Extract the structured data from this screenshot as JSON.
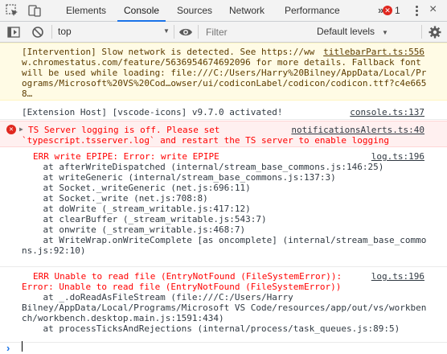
{
  "tabs": {
    "items": [
      "Elements",
      "Console",
      "Sources",
      "Network",
      "Performance"
    ],
    "more": "»",
    "error_count": "1",
    "close": "×"
  },
  "toolbar": {
    "context": "top",
    "filter_placeholder": "Filter",
    "levels": "Default levels"
  },
  "warning": {
    "lines": [
      "[Intervention] Slow network is detected. See https://ww ",
      "w.chromestatus.com/feature/5636954674692096 for more details. Fallback font",
      "will be used while loading: file:///C:/Users/Harry%20Bilney/AppData/Local/Pr",
      "ograms/Microsoft%20VS%20Cod…owser/ui/codiconLabel/codicon/codicon.ttf?c4e665",
      "8…"
    ],
    "source": "titlebarPart.ts:556"
  },
  "info": {
    "text": "[Extension Host] [vscode-icons] v9.7.0 activated!",
    "source": "console.ts:137"
  },
  "error": {
    "lines": [
      "TS Server logging is off. Please set",
      "`typescript.tsserver.log` and restart the TS server to enable logging"
    ],
    "source": "notificationsAlerts.ts:40"
  },
  "log1": {
    "source": "log.ts:196",
    "lines": [
      "ERR write EPIPE: Error: write EPIPE",
      "    at afterWriteDispatched (internal/stream_base_commons.js:146:25)",
      "    at writeGeneric (internal/stream_base_commons.js:137:3)",
      "    at Socket._writeGeneric (net.js:696:11)",
      "    at Socket._write (net.js:708:8)",
      "    at doWrite (_stream_writable.js:417:12)",
      "    at clearBuffer (_stream_writable.js:543:7)",
      "    at onwrite (_stream_writable.js:468:7)",
      "    at WriteWrap.onWriteComplete [as oncomplete] (internal/stream_base_commo",
      "ns.js:92:10)"
    ]
  },
  "log2": {
    "source": "log.ts:196",
    "lines": [
      "ERR Unable to read file (EntryNotFound (FileSystemError)):",
      "Error: Unable to read file (EntryNotFound (FileSystemError))",
      "    at _.doReadAsFileStream (file:///C:/Users/Harry",
      "Bilney/AppData/Local/Programs/Microsoft VS Code/resources/app/out/vs/workben",
      "ch/workbench.desktop.main.js:1591:434)",
      "    at processTicksAndRejections (internal/process/task_queues.js:89:5)"
    ]
  },
  "prompt": "›",
  "colors": {
    "accent": "#1a73e8",
    "error": "#e0271f",
    "warn_bg": "#fffbe5",
    "error_bg": "#fff0f0"
  }
}
